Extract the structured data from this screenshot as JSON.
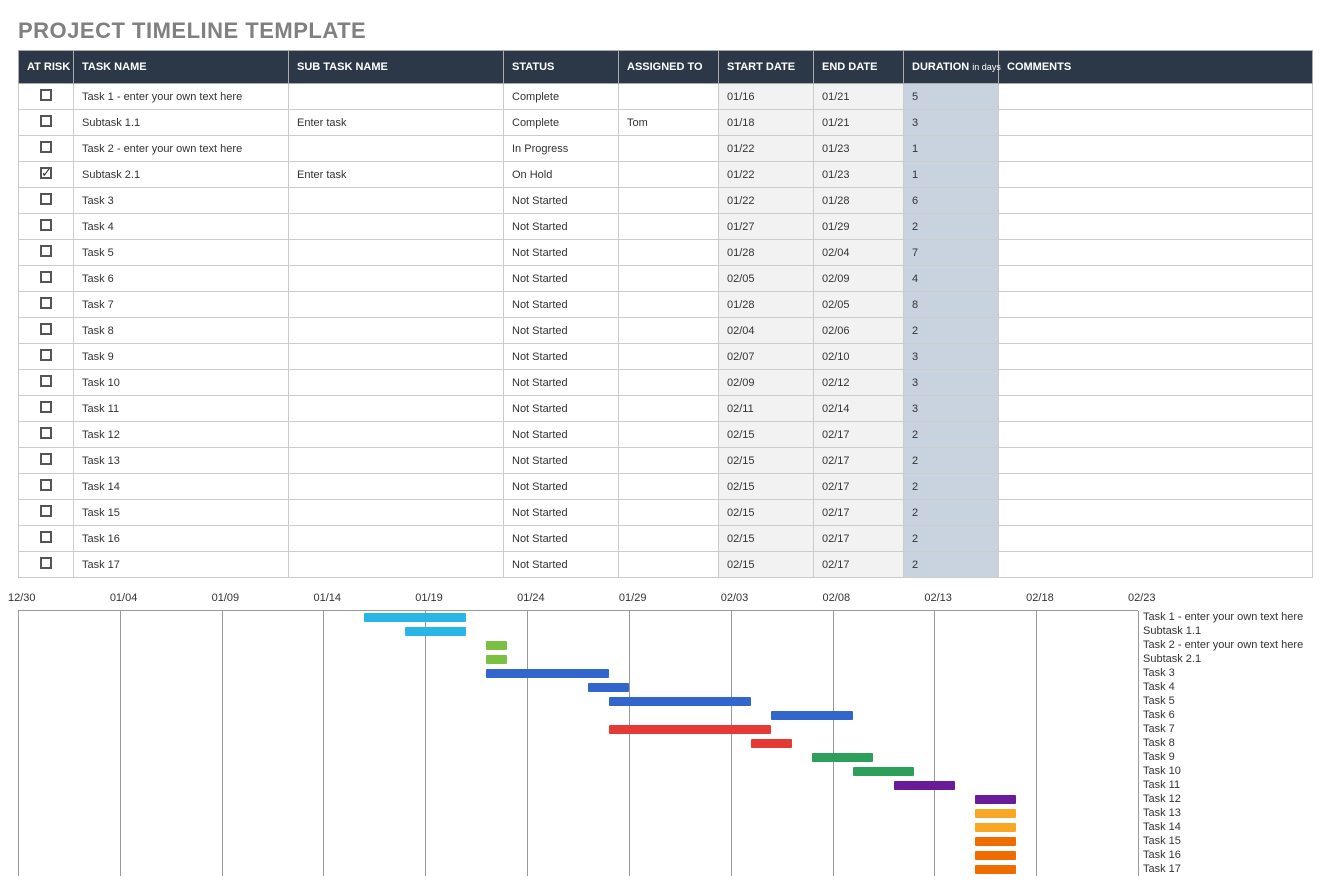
{
  "title": "PROJECT TIMELINE TEMPLATE",
  "headers": {
    "at_risk": "AT RISK",
    "task_name": "TASK NAME",
    "sub_task_name": "SUB TASK NAME",
    "status": "STATUS",
    "assigned_to": "ASSIGNED TO",
    "start_date": "START DATE",
    "end_date": "END DATE",
    "duration": "DURATION",
    "duration_unit": "in days",
    "comments": "COMMENTS"
  },
  "rows": [
    {
      "risk": false,
      "task": "Task 1 - enter your own text here",
      "sub": "",
      "status": "Complete",
      "assigned": "",
      "start": "01/16",
      "end": "01/21",
      "dur": "5",
      "comments": "",
      "color": "#29b6e6"
    },
    {
      "risk": false,
      "task": "Subtask 1.1",
      "sub": "Enter task",
      "status": "Complete",
      "assigned": "Tom",
      "start": "01/18",
      "end": "01/21",
      "dur": "3",
      "comments": "",
      "color": "#29b6e6"
    },
    {
      "risk": false,
      "task": "Task 2 - enter your own text here",
      "sub": "",
      "status": "In Progress",
      "assigned": "",
      "start": "01/22",
      "end": "01/23",
      "dur": "1",
      "comments": "",
      "color": "#7bc043"
    },
    {
      "risk": true,
      "task": "Subtask 2.1",
      "sub": "Enter task",
      "status": "On Hold",
      "assigned": "",
      "start": "01/22",
      "end": "01/23",
      "dur": "1",
      "comments": "",
      "color": "#7bc043"
    },
    {
      "risk": false,
      "task": "Task 3",
      "sub": "",
      "status": "Not Started",
      "assigned": "",
      "start": "01/22",
      "end": "01/28",
      "dur": "6",
      "comments": "",
      "color": "#3366cc"
    },
    {
      "risk": false,
      "task": "Task 4",
      "sub": "",
      "status": "Not Started",
      "assigned": "",
      "start": "01/27",
      "end": "01/29",
      "dur": "2",
      "comments": "",
      "color": "#3366cc"
    },
    {
      "risk": false,
      "task": "Task 5",
      "sub": "",
      "status": "Not Started",
      "assigned": "",
      "start": "01/28",
      "end": "02/04",
      "dur": "7",
      "comments": "",
      "color": "#3366cc"
    },
    {
      "risk": false,
      "task": "Task 6",
      "sub": "",
      "status": "Not Started",
      "assigned": "",
      "start": "02/05",
      "end": "02/09",
      "dur": "4",
      "comments": "",
      "color": "#3366cc"
    },
    {
      "risk": false,
      "task": "Task 7",
      "sub": "",
      "status": "Not Started",
      "assigned": "",
      "start": "01/28",
      "end": "02/05",
      "dur": "8",
      "comments": "",
      "color": "#e53935"
    },
    {
      "risk": false,
      "task": "Task 8",
      "sub": "",
      "status": "Not Started",
      "assigned": "",
      "start": "02/04",
      "end": "02/06",
      "dur": "2",
      "comments": "",
      "color": "#e53935"
    },
    {
      "risk": false,
      "task": "Task 9",
      "sub": "",
      "status": "Not Started",
      "assigned": "",
      "start": "02/07",
      "end": "02/10",
      "dur": "3",
      "comments": "",
      "color": "#2e9e5b"
    },
    {
      "risk": false,
      "task": "Task 10",
      "sub": "",
      "status": "Not Started",
      "assigned": "",
      "start": "02/09",
      "end": "02/12",
      "dur": "3",
      "comments": "",
      "color": "#2e9e5b"
    },
    {
      "risk": false,
      "task": "Task 11",
      "sub": "",
      "status": "Not Started",
      "assigned": "",
      "start": "02/11",
      "end": "02/14",
      "dur": "3",
      "comments": "",
      "color": "#6a1b9a"
    },
    {
      "risk": false,
      "task": "Task 12",
      "sub": "",
      "status": "Not Started",
      "assigned": "",
      "start": "02/15",
      "end": "02/17",
      "dur": "2",
      "comments": "",
      "color": "#6a1b9a"
    },
    {
      "risk": false,
      "task": "Task 13",
      "sub": "",
      "status": "Not Started",
      "assigned": "",
      "start": "02/15",
      "end": "02/17",
      "dur": "2",
      "comments": "",
      "color": "#f9a825"
    },
    {
      "risk": false,
      "task": "Task 14",
      "sub": "",
      "status": "Not Started",
      "assigned": "",
      "start": "02/15",
      "end": "02/17",
      "dur": "2",
      "comments": "",
      "color": "#f9a825"
    },
    {
      "risk": false,
      "task": "Task 15",
      "sub": "",
      "status": "Not Started",
      "assigned": "",
      "start": "02/15",
      "end": "02/17",
      "dur": "2",
      "comments": "",
      "color": "#ef6c00"
    },
    {
      "risk": false,
      "task": "Task 16",
      "sub": "",
      "status": "Not Started",
      "assigned": "",
      "start": "02/15",
      "end": "02/17",
      "dur": "2",
      "comments": "",
      "color": "#ef6c00"
    },
    {
      "risk": false,
      "task": "Task 17",
      "sub": "",
      "status": "Not Started",
      "assigned": "",
      "start": "02/15",
      "end": "02/17",
      "dur": "2",
      "comments": "",
      "color": "#ef6c00"
    }
  ],
  "chart_data": {
    "type": "bar",
    "orientation": "horizontal-gantt",
    "x_axis_ticks": [
      "12/30",
      "01/04",
      "01/09",
      "01/14",
      "01/19",
      "01/24",
      "01/29",
      "02/03",
      "02/08",
      "02/13",
      "02/18",
      "02/23"
    ],
    "x_range_days": {
      "start_label": "12/30",
      "end_label": "02/23",
      "day_span": 55
    },
    "series": [
      {
        "name": "Task 1 - enter your own text here",
        "start": "01/16",
        "end": "01/21",
        "duration_days": 5,
        "color": "#29b6e6"
      },
      {
        "name": "Subtask 1.1",
        "start": "01/18",
        "end": "01/21",
        "duration_days": 3,
        "color": "#29b6e6"
      },
      {
        "name": "Task 2 - enter your own text here",
        "start": "01/22",
        "end": "01/23",
        "duration_days": 1,
        "color": "#7bc043"
      },
      {
        "name": "Subtask 2.1",
        "start": "01/22",
        "end": "01/23",
        "duration_days": 1,
        "color": "#7bc043"
      },
      {
        "name": "Task 3",
        "start": "01/22",
        "end": "01/28",
        "duration_days": 6,
        "color": "#3366cc"
      },
      {
        "name": "Task 4",
        "start": "01/27",
        "end": "01/29",
        "duration_days": 2,
        "color": "#3366cc"
      },
      {
        "name": "Task 5",
        "start": "01/28",
        "end": "02/04",
        "duration_days": 7,
        "color": "#3366cc"
      },
      {
        "name": "Task 6",
        "start": "02/05",
        "end": "02/09",
        "duration_days": 4,
        "color": "#3366cc"
      },
      {
        "name": "Task 7",
        "start": "01/28",
        "end": "02/05",
        "duration_days": 8,
        "color": "#e53935"
      },
      {
        "name": "Task 8",
        "start": "02/04",
        "end": "02/06",
        "duration_days": 2,
        "color": "#e53935"
      },
      {
        "name": "Task 9",
        "start": "02/07",
        "end": "02/10",
        "duration_days": 3,
        "color": "#2e9e5b"
      },
      {
        "name": "Task 10",
        "start": "02/09",
        "end": "02/12",
        "duration_days": 3,
        "color": "#2e9e5b"
      },
      {
        "name": "Task 11",
        "start": "02/11",
        "end": "02/14",
        "duration_days": 3,
        "color": "#6a1b9a"
      },
      {
        "name": "Task 12",
        "start": "02/15",
        "end": "02/17",
        "duration_days": 2,
        "color": "#6a1b9a"
      },
      {
        "name": "Task 13",
        "start": "02/15",
        "end": "02/17",
        "duration_days": 2,
        "color": "#f9a825"
      },
      {
        "name": "Task 14",
        "start": "02/15",
        "end": "02/17",
        "duration_days": 2,
        "color": "#f9a825"
      },
      {
        "name": "Task 15",
        "start": "02/15",
        "end": "02/17",
        "duration_days": 2,
        "color": "#ef6c00"
      },
      {
        "name": "Task 16",
        "start": "02/15",
        "end": "02/17",
        "duration_days": 2,
        "color": "#ef6c00"
      },
      {
        "name": "Task 17",
        "start": "02/15",
        "end": "02/17",
        "duration_days": 2,
        "color": "#ef6c00"
      }
    ]
  }
}
